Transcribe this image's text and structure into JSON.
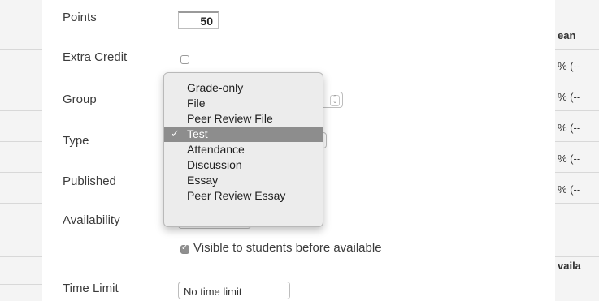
{
  "form": {
    "points_label": "Points",
    "points_value": "50",
    "extra_credit_label": "Extra Credit",
    "group_label": "Group",
    "type_label": "Type",
    "published_label": "Published",
    "availability_label": "Availability",
    "visible_label": "Visible to students before available",
    "time_limit_label": "Time Limit",
    "time_limit_value": "No time limit"
  },
  "dropdown": {
    "selected": "Test",
    "options": [
      "Grade-only",
      "File",
      "Peer Review File",
      "Test",
      "Attendance",
      "Discussion",
      "Essay",
      "Peer Review Essay"
    ]
  },
  "background_table": {
    "header_1": "ean",
    "row_values": [
      "% (--",
      "% (--",
      "% (--",
      "% (--",
      "% (--"
    ],
    "header_2": "vaila"
  },
  "colors": {
    "selection": "#8d8d8d",
    "dropdown_bg": "#ececec",
    "checkbox_checked": "#8f8f8f"
  }
}
